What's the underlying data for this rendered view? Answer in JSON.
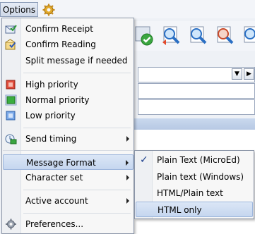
{
  "menubar": {
    "options_label": "Options"
  },
  "main_menu": {
    "items": [
      {
        "label": "Confirm Receipt",
        "icon": "confirm-receipt-icon"
      },
      {
        "label": "Confirm Reading",
        "icon": "confirm-reading-icon"
      },
      {
        "label": "Split message if needed"
      },
      {
        "label": "High priority",
        "icon": "high-priority-icon"
      },
      {
        "label": "Normal priority",
        "icon": "normal-priority-icon"
      },
      {
        "label": "Low priority",
        "icon": "low-priority-icon"
      },
      {
        "label": "Send timing",
        "icon": "send-timing-icon"
      },
      {
        "label": "Message Format"
      },
      {
        "label": "Character set"
      },
      {
        "label": "Active account"
      },
      {
        "label": "Preferences...",
        "icon": "gear-icon"
      }
    ]
  },
  "format_submenu": {
    "items": [
      {
        "label": "Plain Text (MicroEd)",
        "checked": true
      },
      {
        "label": "Plain text (Windows)"
      },
      {
        "label": "HTML/Plain text"
      },
      {
        "label": "HTML only"
      }
    ]
  },
  "colors": {
    "highlight": "#c5d6ef",
    "menu_bg": "#f7f7f7",
    "gutter": "#eef0f3"
  }
}
